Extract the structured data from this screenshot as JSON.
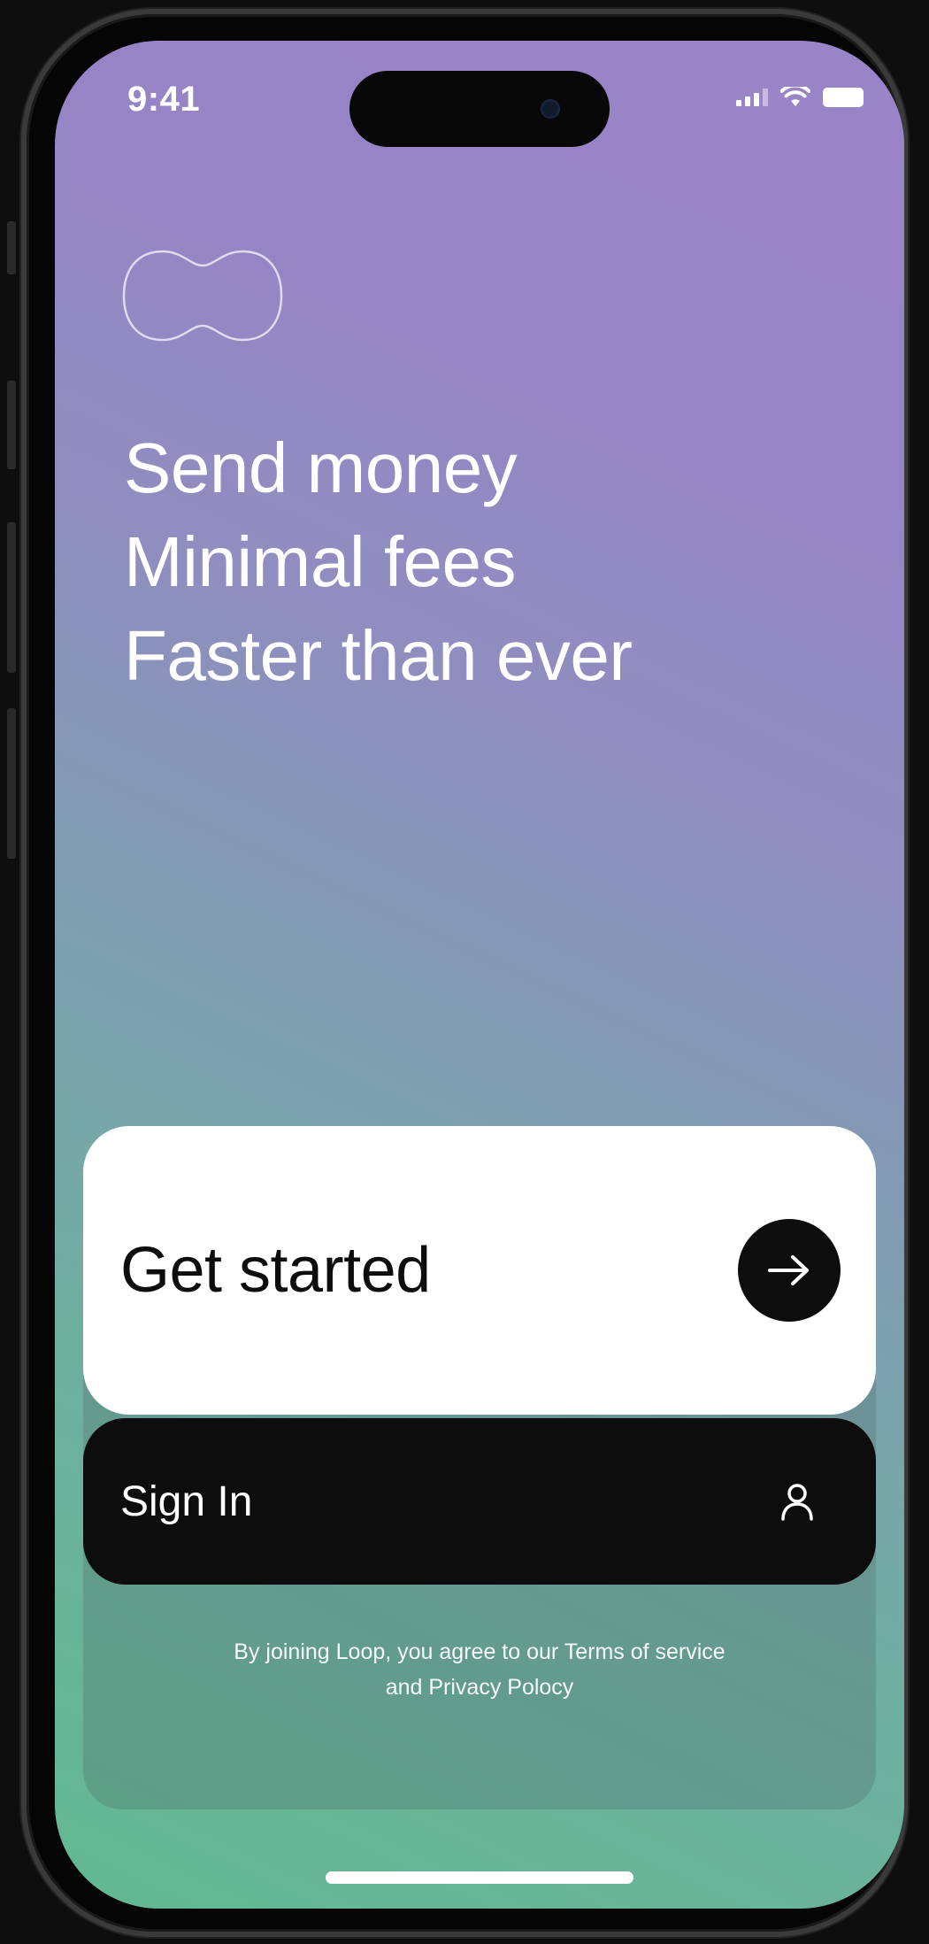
{
  "status_bar": {
    "time": "9:41",
    "signal_icon": "cellular-signal-icon",
    "wifi_icon": "wifi-icon",
    "battery_icon": "battery-icon"
  },
  "brand": {
    "logo_icon": "loop-logo-icon"
  },
  "headline": {
    "lines": [
      "Send money",
      "Minimal fees",
      "Faster than ever"
    ]
  },
  "actions": {
    "get_started_label": "Get started",
    "get_started_icon": "arrow-right-icon",
    "sign_in_label": "Sign In",
    "sign_in_icon": "user-icon"
  },
  "legal": {
    "prefix": "By joining Loop, you agree to our ",
    "terms_link": "Terms of service",
    "middle": "and ",
    "privacy_link": "Privacy Polocy"
  },
  "colors": {
    "gradient_top": "#9a84c8",
    "gradient_bottom": "#62b992",
    "button_light": "#ffffff",
    "button_dark": "#0d0d0d"
  }
}
